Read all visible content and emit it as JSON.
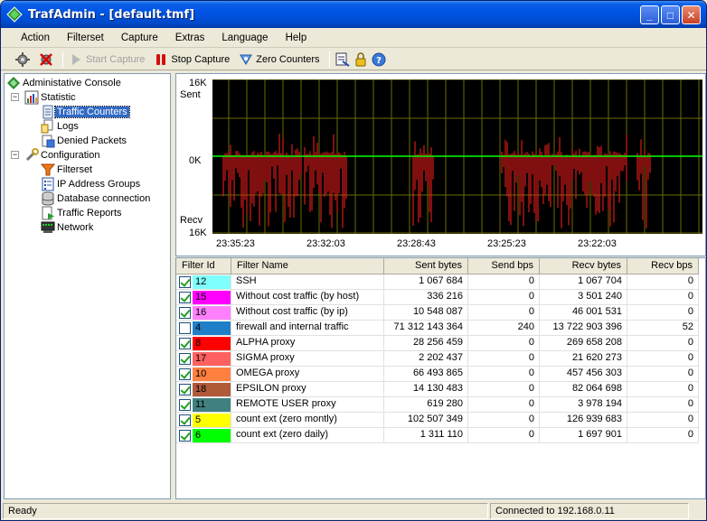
{
  "window": {
    "title": "TrafAdmin - [default.tmf]"
  },
  "menu": [
    "Action",
    "Filterset",
    "Capture",
    "Extras",
    "Language",
    "Help"
  ],
  "toolbar": {
    "start_capture": "Start Capture",
    "stop_capture": "Stop Capture",
    "zero_counters": "Zero Counters"
  },
  "tree": {
    "root": "Administative Console",
    "statistic": "Statistic",
    "traffic_counters": "Traffic Counters",
    "logs": "Logs",
    "denied_packets": "Denied Packets",
    "configuration": "Configuration",
    "filterset": "Filterset",
    "ip_address_groups": "IP Address Groups",
    "database_connection": "Database connection",
    "traffic_reports": "Traffic Reports",
    "network": "Network"
  },
  "chart": {
    "top_value": "16K",
    "top_label": "Sent",
    "zero_label": "0K",
    "bottom_label": "Recv",
    "bottom_value": "16K",
    "time_labels": [
      "23:35:23",
      "23:32:03",
      "23:28:43",
      "23:25:23",
      "23:22:03"
    ],
    "colors": {
      "background": "#000000",
      "grid": "#6b6b00",
      "baseline": "#00ff00",
      "traffic": "#ff2020"
    }
  },
  "table": {
    "columns": [
      "Filter Id",
      "Filter Name",
      "Sent bytes",
      "Send bps",
      "Recv bytes",
      "Recv bps"
    ],
    "rows": [
      {
        "checked": true,
        "id": "12",
        "color": "#80ffff",
        "name": "SSH",
        "sent": "1 067 684",
        "send_bps": "0",
        "recv": "1 067 704",
        "recv_bps": "0"
      },
      {
        "checked": true,
        "id": "15",
        "color": "#ff00ff",
        "name": "Without cost traffic (by host)",
        "sent": "336 216",
        "send_bps": "0",
        "recv": "3 501 240",
        "recv_bps": "0"
      },
      {
        "checked": true,
        "id": "16",
        "color": "#ff80ff",
        "name": "Without cost traffic (by ip)",
        "sent": "10 548 087",
        "send_bps": "0",
        "recv": "46 001 531",
        "recv_bps": "0"
      },
      {
        "checked": false,
        "id": "4",
        "color": "#1e7fc8",
        "name": "firewall and internal traffic",
        "sent": "71 312 143 364",
        "send_bps": "240",
        "recv": "13 722 903 396",
        "recv_bps": "52"
      },
      {
        "checked": true,
        "id": "8",
        "color": "#ff0000",
        "name": "ALPHA proxy",
        "sent": "28 256 459",
        "send_bps": "0",
        "recv": "269 658 208",
        "recv_bps": "0"
      },
      {
        "checked": true,
        "id": "17",
        "color": "#ff6060",
        "name": "SIGMA proxy",
        "sent": "2 202 437",
        "send_bps": "0",
        "recv": "21 620 273",
        "recv_bps": "0"
      },
      {
        "checked": true,
        "id": "10",
        "color": "#ff8040",
        "name": "OMEGA proxy",
        "sent": "66 493 865",
        "send_bps": "0",
        "recv": "457 456 303",
        "recv_bps": "0"
      },
      {
        "checked": true,
        "id": "18",
        "color": "#b05a3a",
        "name": "EPSILON proxy",
        "sent": "14 130 483",
        "send_bps": "0",
        "recv": "82 064 698",
        "recv_bps": "0"
      },
      {
        "checked": true,
        "id": "11",
        "color": "#408080",
        "name": "REMOTE USER proxy",
        "sent": "619 280",
        "send_bps": "0",
        "recv": "3 978 194",
        "recv_bps": "0"
      },
      {
        "checked": true,
        "id": "5",
        "color": "#ffff00",
        "name": "count ext (zero montly)",
        "sent": "102 507 349",
        "send_bps": "0",
        "recv": "126 939 683",
        "recv_bps": "0"
      },
      {
        "checked": true,
        "id": "6",
        "color": "#00ff00",
        "name": "count ext (zero daily)",
        "sent": "1 311 110",
        "send_bps": "0",
        "recv": "1 697 901",
        "recv_bps": "0"
      }
    ]
  },
  "status": {
    "left": "Ready",
    "right": "Connected to 192.168.0.11"
  }
}
